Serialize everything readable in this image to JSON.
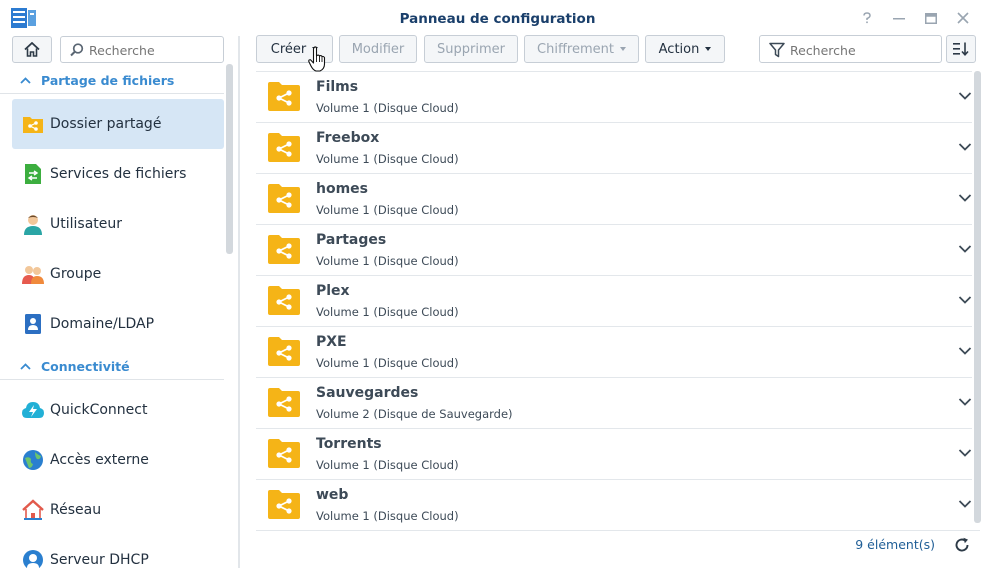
{
  "window": {
    "title": "Panneau de configuration"
  },
  "sidebar": {
    "search_placeholder": "Recherche",
    "sections": [
      {
        "label": "Partage de fichiers"
      },
      {
        "label": "Connectivité"
      }
    ],
    "items": [
      {
        "label": "Dossier partagé",
        "icon": "shared-folder-icon",
        "active": true
      },
      {
        "label": "Services de fichiers",
        "icon": "file-services-icon"
      },
      {
        "label": "Utilisateur",
        "icon": "user-icon"
      },
      {
        "label": "Groupe",
        "icon": "group-icon"
      },
      {
        "label": "Domaine/LDAP",
        "icon": "domain-ldap-icon"
      },
      {
        "label": "QuickConnect",
        "icon": "quickconnect-icon"
      },
      {
        "label": "Accès externe",
        "icon": "external-access-icon"
      },
      {
        "label": "Réseau",
        "icon": "network-icon"
      },
      {
        "label": "Serveur DHCP",
        "icon": "dhcp-server-icon"
      }
    ]
  },
  "toolbar": {
    "create": "Créer",
    "edit": "Modifier",
    "delete": "Supprimer",
    "encryption": "Chiffrement",
    "action": "Action",
    "search_placeholder": "Recherche"
  },
  "folders": [
    {
      "name": "Films",
      "volume": "Volume 1 (Disque Cloud)"
    },
    {
      "name": "Freebox",
      "volume": "Volume 1 (Disque Cloud)"
    },
    {
      "name": "homes",
      "volume": "Volume 1 (Disque Cloud)"
    },
    {
      "name": "Partages",
      "volume": "Volume 1 (Disque Cloud)"
    },
    {
      "name": "Plex",
      "volume": "Volume 1 (Disque Cloud)"
    },
    {
      "name": "PXE",
      "volume": "Volume 1 (Disque Cloud)"
    },
    {
      "name": "Sauvegardes",
      "volume": "Volume 2 (Disque de Sauvegarde)"
    },
    {
      "name": "Torrents",
      "volume": "Volume 1 (Disque Cloud)"
    },
    {
      "name": "web",
      "volume": "Volume 1 (Disque Cloud)"
    }
  ],
  "footer": {
    "count": "9 élément(s)"
  },
  "colors": {
    "accent": "#3a8bd0",
    "folder": "#f5b417",
    "active_bg": "#d6e6f5",
    "title": "#1a3f6b"
  }
}
